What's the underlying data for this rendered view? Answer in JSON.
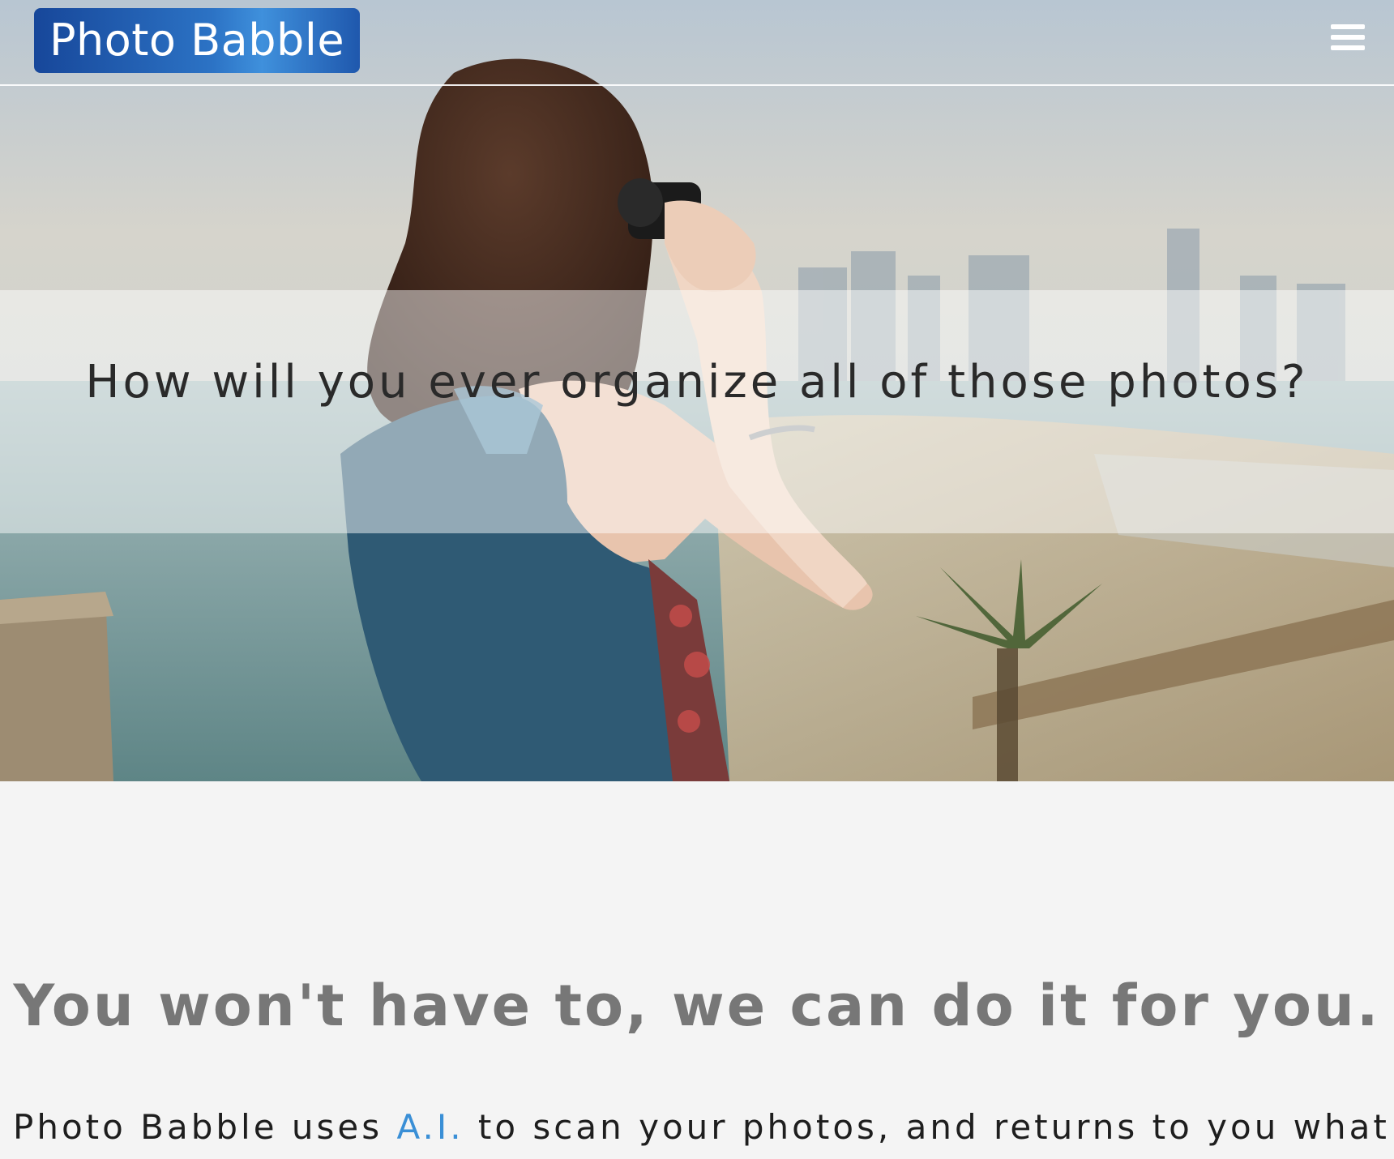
{
  "nav": {
    "brand": "Photo Babble",
    "menu_icon": "hamburger-menu-icon"
  },
  "hero": {
    "tagline": "How will you ever organize all of those photos?",
    "image": "woman-taking-photo-of-city-skyline-by-the-sea"
  },
  "main": {
    "headline": "You won't have to, we can do it for you.",
    "body_before": "Photo Babble uses ",
    "body_link": "A.I.",
    "body_after": " to scan your photos, and returns to you what"
  },
  "colors": {
    "brand_bg": "#2c73c5",
    "link": "#3a8fd6",
    "page_bg": "#f4f4f4",
    "headline": "#777777"
  }
}
